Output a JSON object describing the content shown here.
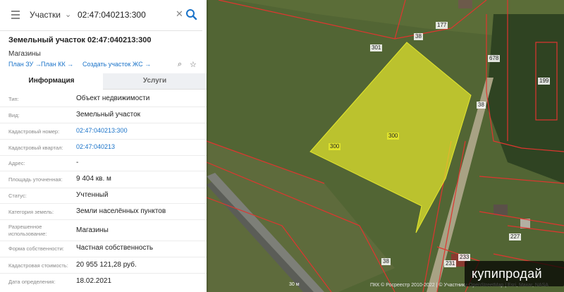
{
  "search": {
    "layer": "Участки",
    "value": "02:47:040213:300"
  },
  "parcel": {
    "title": "Земельный участок 02:47:040213:300",
    "usage": "Магазины",
    "links": [
      "План ЗУ →",
      "План КК →",
      "Создать участок ЖС →"
    ]
  },
  "tabs": [
    "Информация",
    "Услуги"
  ],
  "info": [
    {
      "key": "Тип:",
      "value": "Объект недвижимости"
    },
    {
      "key": "Вид:",
      "value": "Земельный участок"
    },
    {
      "key": "Кадастровый номер:",
      "value": "02:47:040213:300"
    },
    {
      "key": "Кадастровый квартал:",
      "value": "02:47:040213"
    },
    {
      "key": "Адрес:",
      "value": "-"
    },
    {
      "key": "Площадь уточненная:",
      "value": "9 404 кв. м"
    },
    {
      "key": "Статус:",
      "value": "Учтенный"
    },
    {
      "key": "Категория земель:",
      "value": "Земли населённых пунктов"
    },
    {
      "key": "Разрешенное использование:",
      "value": "Магазины"
    },
    {
      "key": "Форма собственности:",
      "value": "Частная собственность"
    },
    {
      "key": "Кадастровая стоимость:",
      "value": "20 955 121,28 руб."
    },
    {
      "key": "Дата определения:",
      "value": "18.02.2021"
    }
  ],
  "map": {
    "labels": [
      "177",
      "38",
      "301",
      "678",
      "199",
      "300",
      "300",
      "38",
      "227",
      "231",
      "38",
      "233"
    ],
    "scale": "30 м",
    "copyright": "ПКК © Росреестр 2010-2022 | © Участники OpenStreetMap | Esri, Maxar, NASA"
  },
  "watermark": "купипродай",
  "colors": {
    "link": "#1a73c9",
    "search": "#1a73c9",
    "parcel_fill": "#e3e62c",
    "boundary": "#e0352f"
  }
}
